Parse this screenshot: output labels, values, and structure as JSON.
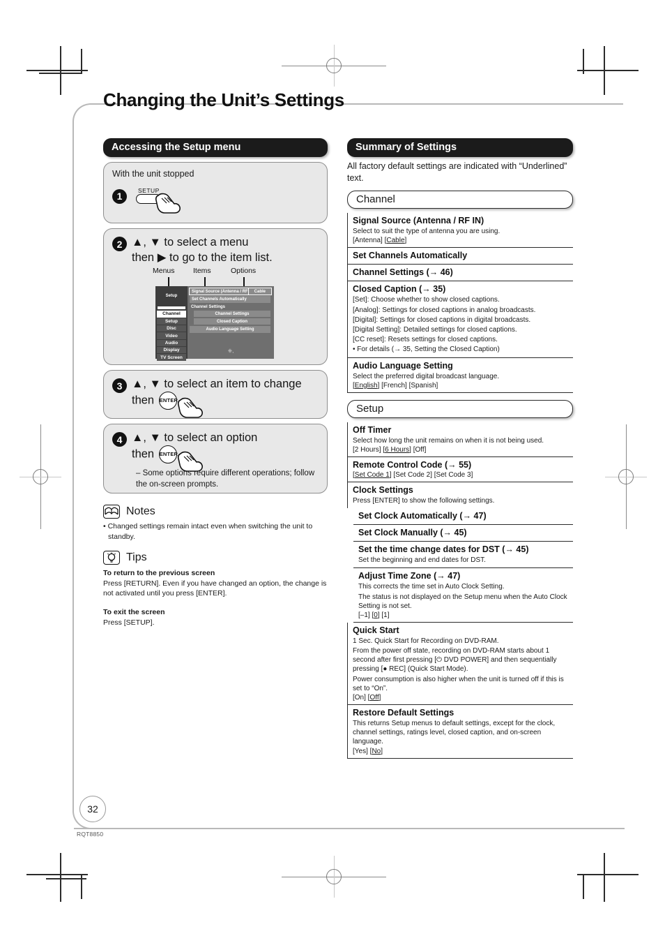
{
  "page": {
    "title": "Changing the Unit’s Settings",
    "number": "32",
    "model_code": "RQT8850"
  },
  "left_column": {
    "banner": "Accessing the Setup menu",
    "step1": {
      "intro": "With the unit stopped",
      "number": "1",
      "key_label": "SETUP"
    },
    "step2": {
      "number": "2",
      "line1": "▲, ▼ to select a menu",
      "line2_pre": "then",
      "line2_arrow": "▶",
      "line2_post": "to go to the item list.",
      "diagram": {
        "label_menus": "Menus",
        "label_items": "Items",
        "label_options": "Options",
        "screen_title": "Setup",
        "menus": [
          "Channel",
          "Setup",
          "Disc",
          "Video",
          "Audio",
          "Display",
          "TV Screen"
        ],
        "active_menu": "Channel",
        "items": [
          "Signal Source (Antenna / RF IN)",
          "Set Channels Automatically",
          "Channel Settings",
          "Channel Settings",
          "Closed Caption",
          "Audio Language Setting"
        ],
        "option_value": "Cable"
      }
    },
    "step3": {
      "number": "3",
      "line1": "▲, ▼ to select an item to change",
      "line2_pre": "then",
      "key_label": "ENTER"
    },
    "step4": {
      "number": "4",
      "line1": "▲, ▼ to select an option",
      "line2_pre": "then",
      "key_label": "ENTER",
      "note": "– Some options require different operations; follow the on-screen prompts."
    },
    "notes": {
      "heading": "Notes",
      "items": [
        "• Changed settings remain intact even when switching the unit to standby."
      ]
    },
    "tips": {
      "heading": "Tips",
      "blocks": [
        {
          "subhead": "To return to the previous screen",
          "text": "Press [RETURN]. Even if you have changed an option, the change is not activated until you press [ENTER]."
        },
        {
          "subhead": "To exit the screen",
          "text": "Press [SETUP]."
        }
      ]
    }
  },
  "right_column": {
    "banner": "Summary of Settings",
    "intro": "All factory default settings are indicated with “Underlined” text.",
    "sections": [
      {
        "pill": "Channel",
        "entries": [
          {
            "title": "Signal Source (Antenna / RF IN)",
            "desc": [
              "Select to suit the type of antenna you are using."
            ],
            "options_html": "[Antenna] [<span class=\"u\">Cable</span>]"
          },
          {
            "title": "Set Channels Automatically",
            "desc": [],
            "options_html": ""
          },
          {
            "title": "Channel Settings (→ 46)",
            "desc": [],
            "options_html": ""
          },
          {
            "title": "Closed Caption (→ 35)",
            "desc": [
              "[Set]: Choose whether to show closed captions.",
              "[Analog]: Settings for closed captions in analog broadcasts.",
              "[Digital]: Settings for closed captions in digital broadcasts.",
              "[Digital Setting]: Detailed settings for closed captions.",
              "[CC reset]:  Resets settings for closed captions.",
              "• For details (→ 35, Setting the Closed Caption)"
            ],
            "options_html": ""
          },
          {
            "title": "Audio Language Setting",
            "desc": [
              "Select the preferred digital broadcast language."
            ],
            "options_html": "[<span class=\"u\">English</span>] [French] [Spanish]"
          }
        ]
      },
      {
        "pill": "Setup",
        "entries": [
          {
            "title": "Off Timer",
            "desc": [
              "Select how long the unit remains on when it is not being used."
            ],
            "options_html": "[2 Hours] [<span class=\"u\">6 Hours</span>] [Off]"
          },
          {
            "title": "Remote Control Code (→ 55)",
            "desc": [],
            "options_html": "[<span class=\"u\">Set Code 1</span>] [Set Code 2] [Set Code 3]"
          },
          {
            "title": "Clock Settings",
            "desc": [
              "Press [ENTER] to show the following settings."
            ],
            "options_html": "",
            "no_bottom_border": true
          },
          {
            "title": "Set Clock Automatically (→ 47)",
            "desc": [],
            "options_html": "",
            "sub": true
          },
          {
            "title": "Set Clock Manually (→ 45)",
            "desc": [],
            "options_html": "",
            "sub": true
          },
          {
            "title": "Set the time change dates for DST (→ 45)",
            "desc": [
              "Set the beginning and end dates for DST."
            ],
            "options_html": "",
            "sub": true
          },
          {
            "title": "Adjust Time Zone (→ 47)",
            "desc": [
              "This corrects the time set in Auto Clock Setting.",
              "The status is not displayed on the Setup menu when the Auto Clock Setting is not set."
            ],
            "options_html": "[–1] [<span class=\"u\">0</span>] [1]",
            "sub": true
          },
          {
            "title": "Quick Start",
            "desc": [
              "1 Sec. Quick Start for Recording on DVD-RAM.",
              "From the power off state, recording on DVD-RAM starts about 1 second after first pressing [⏻ DVD POWER] and then sequentially pressing [● REC] (Quick Start Mode).",
              "Power consumption is also higher when the unit is turned off if this is set to “On”."
            ],
            "options_html": "[On] [<span class=\"u\">Off</span>]"
          },
          {
            "title": "Restore Default Settings",
            "desc": [
              "This returns Setup menus to default settings, except for the clock, channel settings, ratings level, closed caption, and on-screen language."
            ],
            "options_html": "[Yes] [<span class=\"u\">No</span>]"
          }
        ]
      }
    ]
  }
}
